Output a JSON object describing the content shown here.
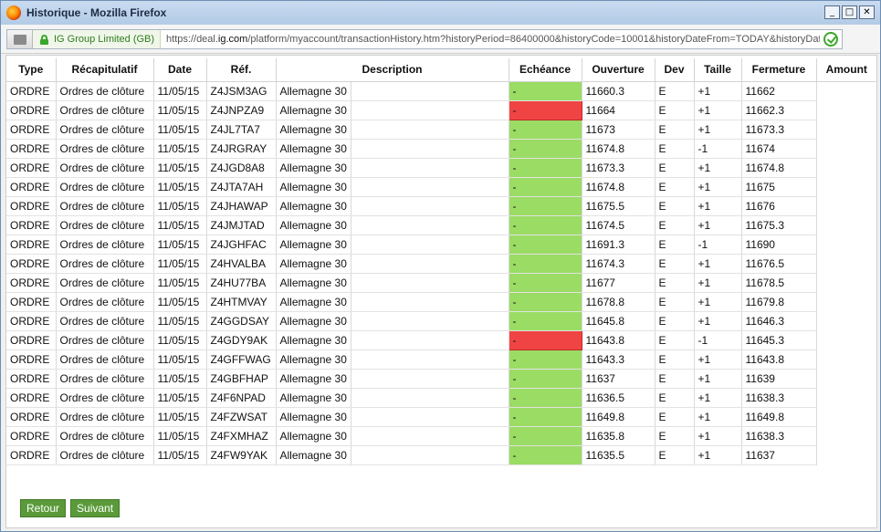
{
  "window": {
    "title": "Historique - Mozilla Firefox",
    "buttons": {
      "minimize": "_",
      "maximize": "□",
      "close": "✕"
    }
  },
  "urlbar": {
    "identity": "IG Group Limited (GB)",
    "url_prefix": "https://deal.",
    "url_domain": "ig.com",
    "url_rest": "/platform/myaccount/transactionHistory.htm?historyPeriod=86400000&historyCode=10001&historyDateFrom=TODAY&historyDat"
  },
  "table": {
    "headers": [
      "Type",
      "Récapitulatif",
      "Date",
      "Réf.",
      "Description",
      "Echéance",
      "Ouverture",
      "Dev",
      "Taille",
      "Fermeture",
      "Amount"
    ],
    "rows": [
      {
        "type": "ORDRE",
        "recap": "Ordres de clôture",
        "date": "11/05/15",
        "ref": "Z4JSM3AG",
        "desc": "Allemagne 30",
        "ech": "-",
        "ech_status": "green",
        "open": "11660.3",
        "dev": "E",
        "size": "+1",
        "close": "11662"
      },
      {
        "type": "ORDRE",
        "recap": "Ordres de clôture",
        "date": "11/05/15",
        "ref": "Z4JNPZA9",
        "desc": "Allemagne 30",
        "ech": "-",
        "ech_status": "red",
        "open": "11664",
        "dev": "E",
        "size": "+1",
        "close": "11662.3"
      },
      {
        "type": "ORDRE",
        "recap": "Ordres de clôture",
        "date": "11/05/15",
        "ref": "Z4JL7TA7",
        "desc": "Allemagne 30",
        "ech": "-",
        "ech_status": "green",
        "open": "11673",
        "dev": "E",
        "size": "+1",
        "close": "11673.3"
      },
      {
        "type": "ORDRE",
        "recap": "Ordres de clôture",
        "date": "11/05/15",
        "ref": "Z4JRGRAY",
        "desc": "Allemagne 30",
        "ech": "-",
        "ech_status": "green",
        "open": "11674.8",
        "dev": "E",
        "size": "-1",
        "close": "11674"
      },
      {
        "type": "ORDRE",
        "recap": "Ordres de clôture",
        "date": "11/05/15",
        "ref": "Z4JGD8A8",
        "desc": "Allemagne 30",
        "ech": "-",
        "ech_status": "green",
        "open": "11673.3",
        "dev": "E",
        "size": "+1",
        "close": "11674.8"
      },
      {
        "type": "ORDRE",
        "recap": "Ordres de clôture",
        "date": "11/05/15",
        "ref": "Z4JTA7AH",
        "desc": "Allemagne 30",
        "ech": "-",
        "ech_status": "green",
        "open": "11674.8",
        "dev": "E",
        "size": "+1",
        "close": "11675"
      },
      {
        "type": "ORDRE",
        "recap": "Ordres de clôture",
        "date": "11/05/15",
        "ref": "Z4JHAWAP",
        "desc": "Allemagne 30",
        "ech": "-",
        "ech_status": "green",
        "open": "11675.5",
        "dev": "E",
        "size": "+1",
        "close": "11676"
      },
      {
        "type": "ORDRE",
        "recap": "Ordres de clôture",
        "date": "11/05/15",
        "ref": "Z4JMJTAD",
        "desc": "Allemagne 30",
        "ech": "-",
        "ech_status": "green",
        "open": "11674.5",
        "dev": "E",
        "size": "+1",
        "close": "11675.3"
      },
      {
        "type": "ORDRE",
        "recap": "Ordres de clôture",
        "date": "11/05/15",
        "ref": "Z4JGHFAC",
        "desc": "Allemagne 30",
        "ech": "-",
        "ech_status": "green",
        "open": "11691.3",
        "dev": "E",
        "size": "-1",
        "close": "11690"
      },
      {
        "type": "ORDRE",
        "recap": "Ordres de clôture",
        "date": "11/05/15",
        "ref": "Z4HVALBA",
        "desc": "Allemagne 30",
        "ech": "-",
        "ech_status": "green",
        "open": "11674.3",
        "dev": "E",
        "size": "+1",
        "close": "11676.5"
      },
      {
        "type": "ORDRE",
        "recap": "Ordres de clôture",
        "date": "11/05/15",
        "ref": "Z4HU77BA",
        "desc": "Allemagne 30",
        "ech": "-",
        "ech_status": "green",
        "open": "11677",
        "dev": "E",
        "size": "+1",
        "close": "11678.5"
      },
      {
        "type": "ORDRE",
        "recap": "Ordres de clôture",
        "date": "11/05/15",
        "ref": "Z4HTMVAY",
        "desc": "Allemagne 30",
        "ech": "-",
        "ech_status": "green",
        "open": "11678.8",
        "dev": "E",
        "size": "+1",
        "close": "11679.8"
      },
      {
        "type": "ORDRE",
        "recap": "Ordres de clôture",
        "date": "11/05/15",
        "ref": "Z4GGDSAY",
        "desc": "Allemagne 30",
        "ech": "-",
        "ech_status": "green",
        "open": "11645.8",
        "dev": "E",
        "size": "+1",
        "close": "11646.3"
      },
      {
        "type": "ORDRE",
        "recap": "Ordres de clôture",
        "date": "11/05/15",
        "ref": "Z4GDY9AK",
        "desc": "Allemagne 30",
        "ech": "-",
        "ech_status": "red",
        "open": "11643.8",
        "dev": "E",
        "size": "-1",
        "close": "11645.3"
      },
      {
        "type": "ORDRE",
        "recap": "Ordres de clôture",
        "date": "11/05/15",
        "ref": "Z4GFFWAG",
        "desc": "Allemagne 30",
        "ech": "-",
        "ech_status": "green",
        "open": "11643.3",
        "dev": "E",
        "size": "+1",
        "close": "11643.8"
      },
      {
        "type": "ORDRE",
        "recap": "Ordres de clôture",
        "date": "11/05/15",
        "ref": "Z4GBFHAP",
        "desc": "Allemagne 30",
        "ech": "-",
        "ech_status": "green",
        "open": "11637",
        "dev": "E",
        "size": "+1",
        "close": "11639"
      },
      {
        "type": "ORDRE",
        "recap": "Ordres de clôture",
        "date": "11/05/15",
        "ref": "Z4F6NPAD",
        "desc": "Allemagne 30",
        "ech": "-",
        "ech_status": "green",
        "open": "11636.5",
        "dev": "E",
        "size": "+1",
        "close": "11638.3"
      },
      {
        "type": "ORDRE",
        "recap": "Ordres de clôture",
        "date": "11/05/15",
        "ref": "Z4FZWSAT",
        "desc": "Allemagne 30",
        "ech": "-",
        "ech_status": "green",
        "open": "11649.8",
        "dev": "E",
        "size": "+1",
        "close": "11649.8"
      },
      {
        "type": "ORDRE",
        "recap": "Ordres de clôture",
        "date": "11/05/15",
        "ref": "Z4FXMHAZ",
        "desc": "Allemagne 30",
        "ech": "-",
        "ech_status": "green",
        "open": "11635.8",
        "dev": "E",
        "size": "+1",
        "close": "11638.3"
      },
      {
        "type": "ORDRE",
        "recap": "Ordres de clôture",
        "date": "11/05/15",
        "ref": "Z4FW9YAK",
        "desc": "Allemagne 30",
        "ech": "-",
        "ech_status": "green",
        "open": "11635.5",
        "dev": "E",
        "size": "+1",
        "close": "11637"
      }
    ]
  },
  "footer": {
    "back_label": "Retour",
    "next_label": "Suivant"
  },
  "colors": {
    "green_status": "#9bdc64",
    "red_status": "#f04444",
    "button_green": "#5a9a3a"
  }
}
